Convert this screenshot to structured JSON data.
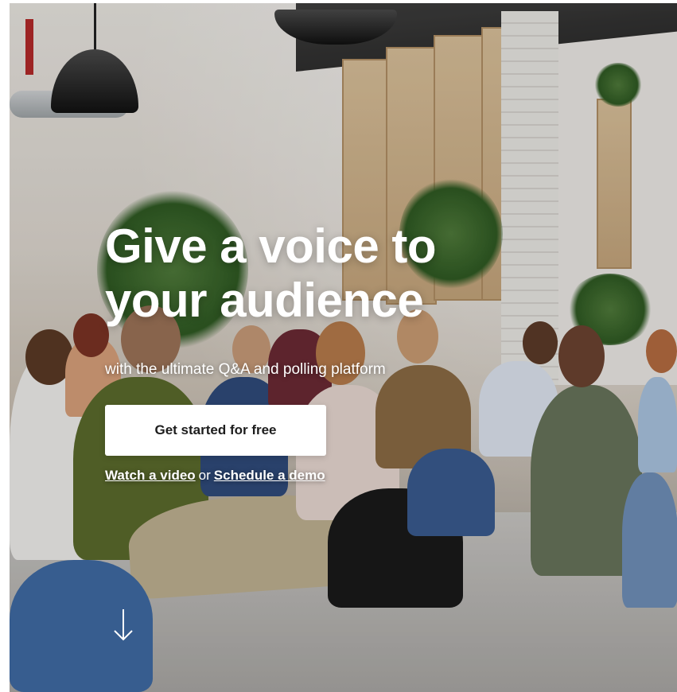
{
  "hero": {
    "headline_line1": "Give a voice to",
    "headline_line2": "your audience",
    "subheadline": "with the ultimate Q&A and polling platform",
    "cta_label": "Get started for free",
    "watch_video_label": "Watch a video",
    "or_text": "or",
    "schedule_demo_label": "Schedule a demo",
    "scroll_icon": "arrow-down-icon"
  },
  "colors": {
    "text": "#ffffff",
    "button_bg": "#ffffff",
    "button_text": "#1d1d1d"
  }
}
